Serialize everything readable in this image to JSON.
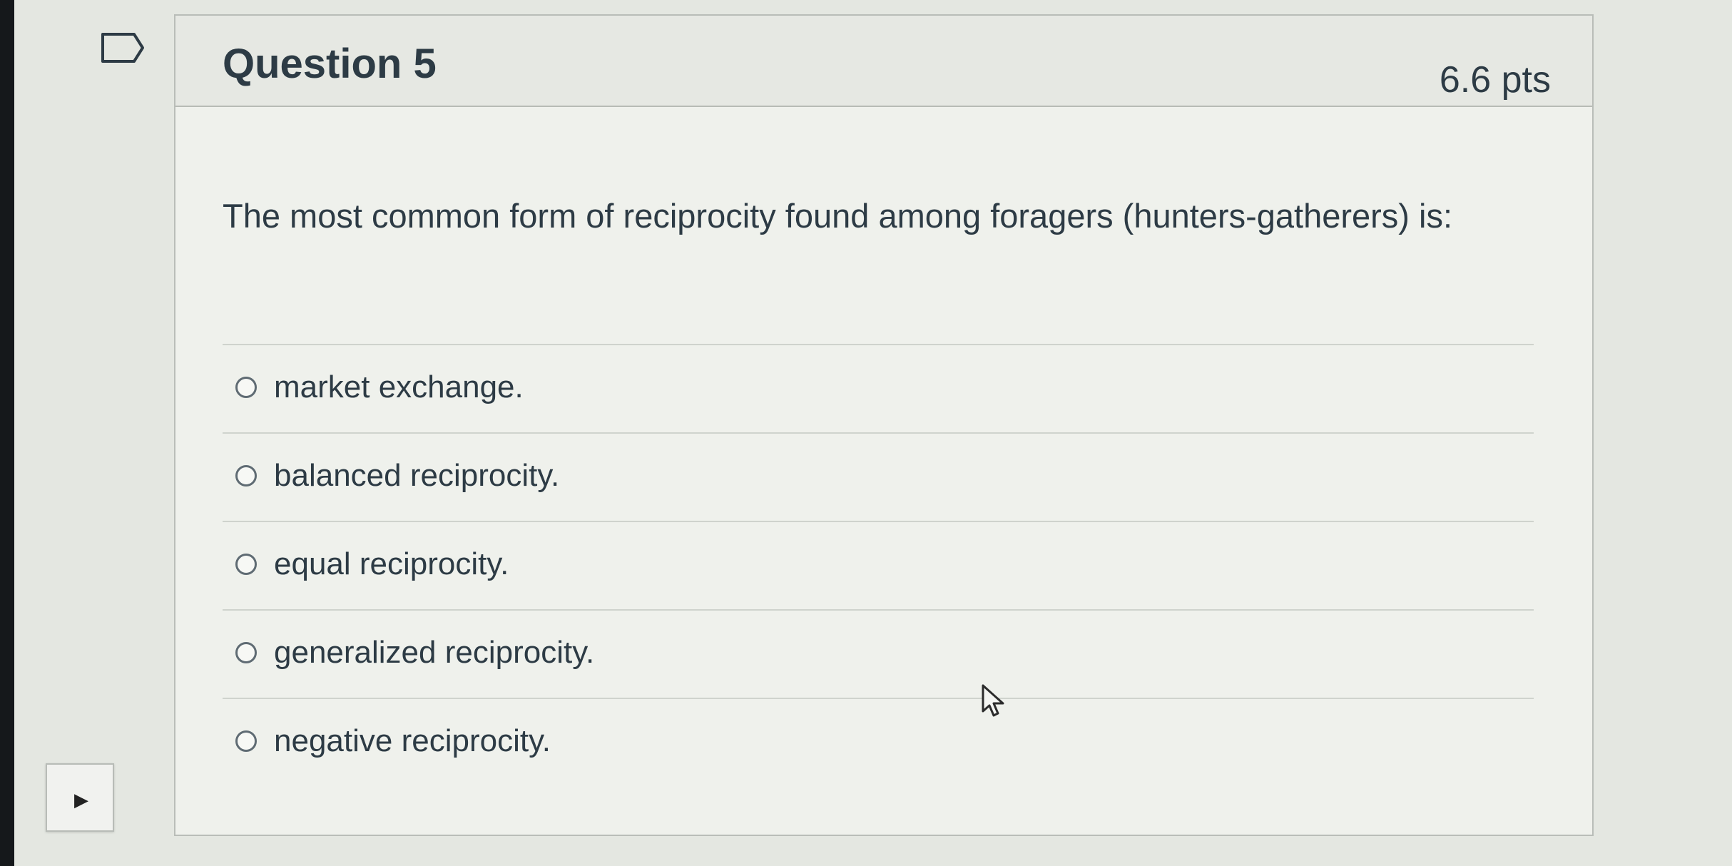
{
  "question": {
    "title": "Question 5",
    "points": "6.6 pts",
    "text": "The most common form of reciprocity found among foragers (hunters-gatherers) is:",
    "answers": [
      {
        "label": "market exchange."
      },
      {
        "label": "balanced reciprocity."
      },
      {
        "label": "equal reciprocity."
      },
      {
        "label": "generalized reciprocity."
      },
      {
        "label": "negative reciprocity."
      }
    ]
  },
  "icons": {
    "flag": "flag-outline-icon",
    "cursor": "mouse-pointer-hand-icon",
    "toggle": "triangle-right-icon"
  },
  "colors": {
    "text": "#2d3b45",
    "border": "#b9bdb8",
    "radio": "#5f6b73"
  },
  "side_toggle": {
    "glyph": "▶"
  }
}
